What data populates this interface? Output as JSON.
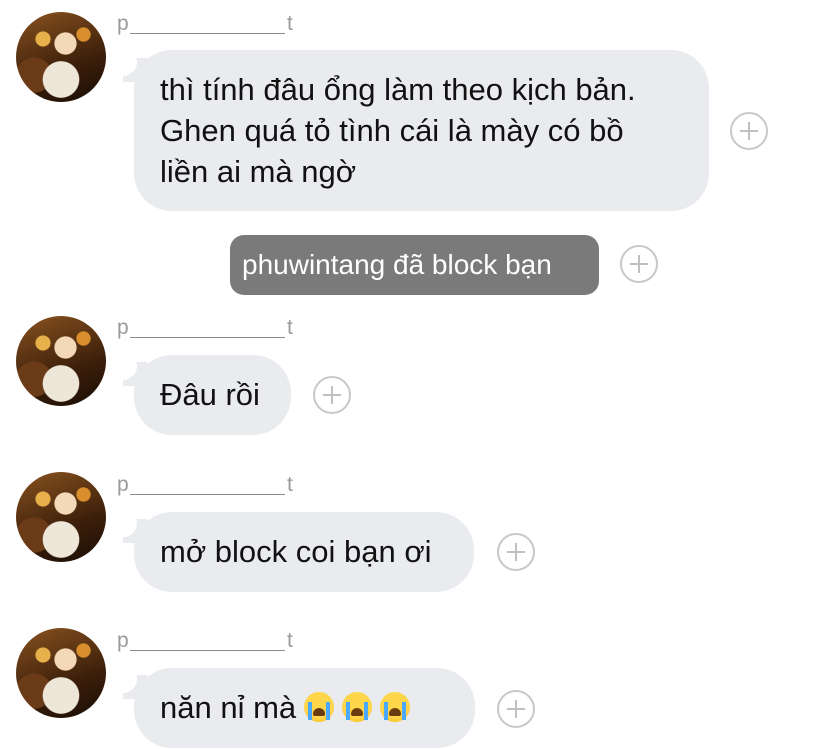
{
  "sender_name_start": "p",
  "sender_name_end": "t",
  "messages": [
    {
      "lines": [
        "thì tính đâu ổng làm theo kịch bản.",
        "Ghen quá tỏ tình cái là mày có bồ",
        "liền ai mà ngờ"
      ]
    },
    {
      "text": "Đâu rồi"
    },
    {
      "text": "mở block coi bạn ơi"
    },
    {
      "text": "năn nỉ mà"
    }
  ],
  "system_notice": "phuwintang đã block bạn",
  "emoji_names": [
    "loudly-crying-face",
    "loudly-crying-face",
    "loudly-crying-face"
  ]
}
